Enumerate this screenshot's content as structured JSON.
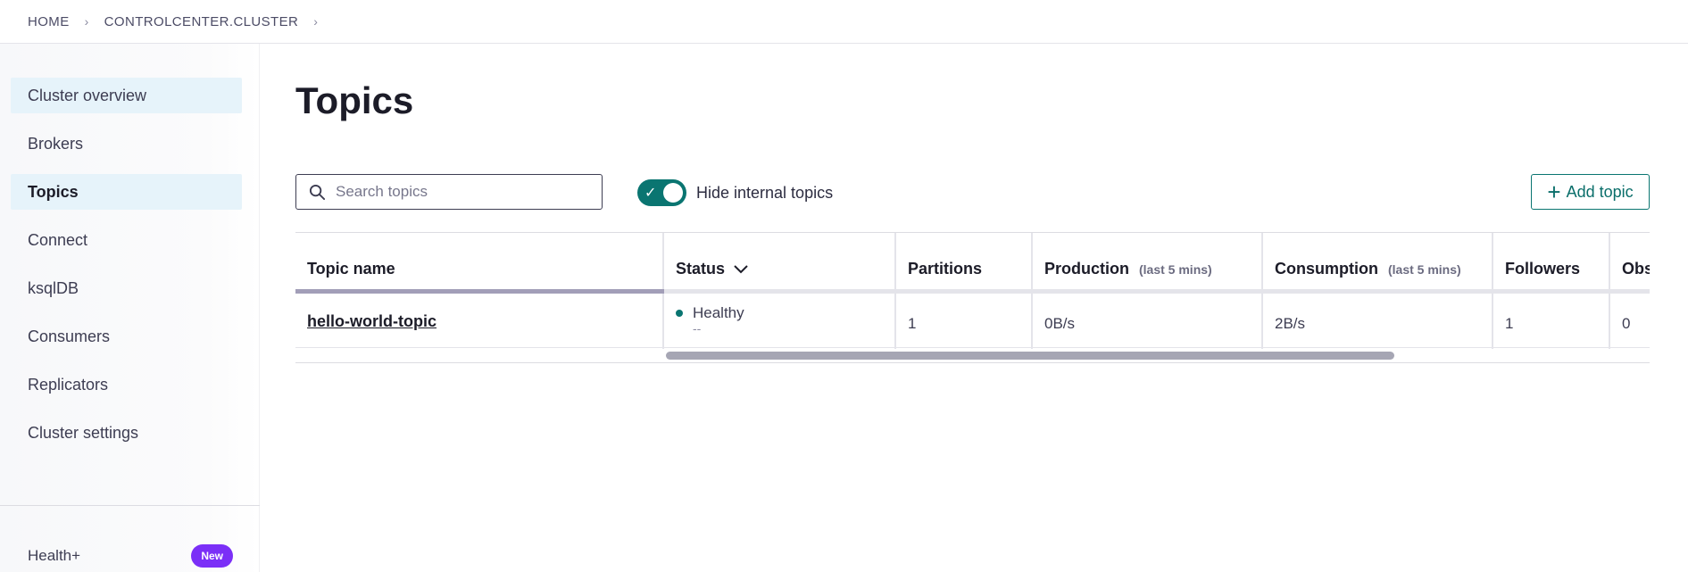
{
  "breadcrumb": {
    "items": [
      "HOME",
      "CONTROLCENTER.CLUSTER"
    ],
    "separator": "›"
  },
  "sidebar": {
    "items": [
      {
        "label": "Cluster overview"
      },
      {
        "label": "Brokers"
      },
      {
        "label": "Topics"
      },
      {
        "label": "Connect"
      },
      {
        "label": "ksqlDB"
      },
      {
        "label": "Consumers"
      },
      {
        "label": "Replicators"
      },
      {
        "label": "Cluster settings"
      }
    ],
    "footer": {
      "label": "Health+",
      "badge": "New"
    }
  },
  "page": {
    "title": "Topics"
  },
  "toolbar": {
    "search_placeholder": "Search topics",
    "search_value": "",
    "toggle_label": "Hide internal topics",
    "toggle_on": true,
    "add_button_label": "Add topic"
  },
  "table": {
    "headers": {
      "topic_name": "Topic name",
      "status": "Status",
      "partitions": "Partitions",
      "production": "Production",
      "production_sub": "(last 5 mins)",
      "consumption": "Consumption",
      "consumption_sub": "(last 5 mins)",
      "followers": "Followers",
      "obs": "Obs"
    },
    "rows": [
      {
        "topic_name": "hello-world-topic",
        "status": "Healthy",
        "status_sub": "--",
        "partitions": "1",
        "production": "0B/s",
        "consumption": "2B/s",
        "followers": "1",
        "obs": "0"
      }
    ]
  },
  "colors": {
    "accent": "#0a7571",
    "badge": "#7b2ff7",
    "nav_active_bg": "#e6f3fa"
  }
}
